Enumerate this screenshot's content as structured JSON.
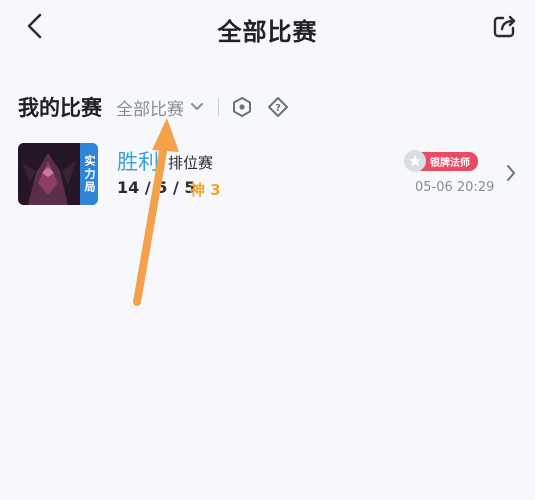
{
  "header": {
    "title": "全部比赛",
    "back_icon": "chevron-left-icon",
    "share_icon": "share-icon"
  },
  "section": {
    "title": "我的比赛",
    "filter_label": "全部比赛",
    "filter_icon": "chevron-down-icon",
    "hex_icon": "hexagon-icon",
    "help_icon": "question-diamond-icon"
  },
  "match": {
    "mode_tag": "实力局",
    "result": "胜利",
    "queue_type": "排位赛",
    "kda": "14 / 5 / 5",
    "mvp": "神 3",
    "badge_label": "银牌法师",
    "time": "05-06 20:29",
    "result_color": "#3aa3d6",
    "badge_color": "#e84b63",
    "tag_color": "#2f86d8"
  },
  "annotation": {
    "arrow_color": "#f5a04a"
  }
}
